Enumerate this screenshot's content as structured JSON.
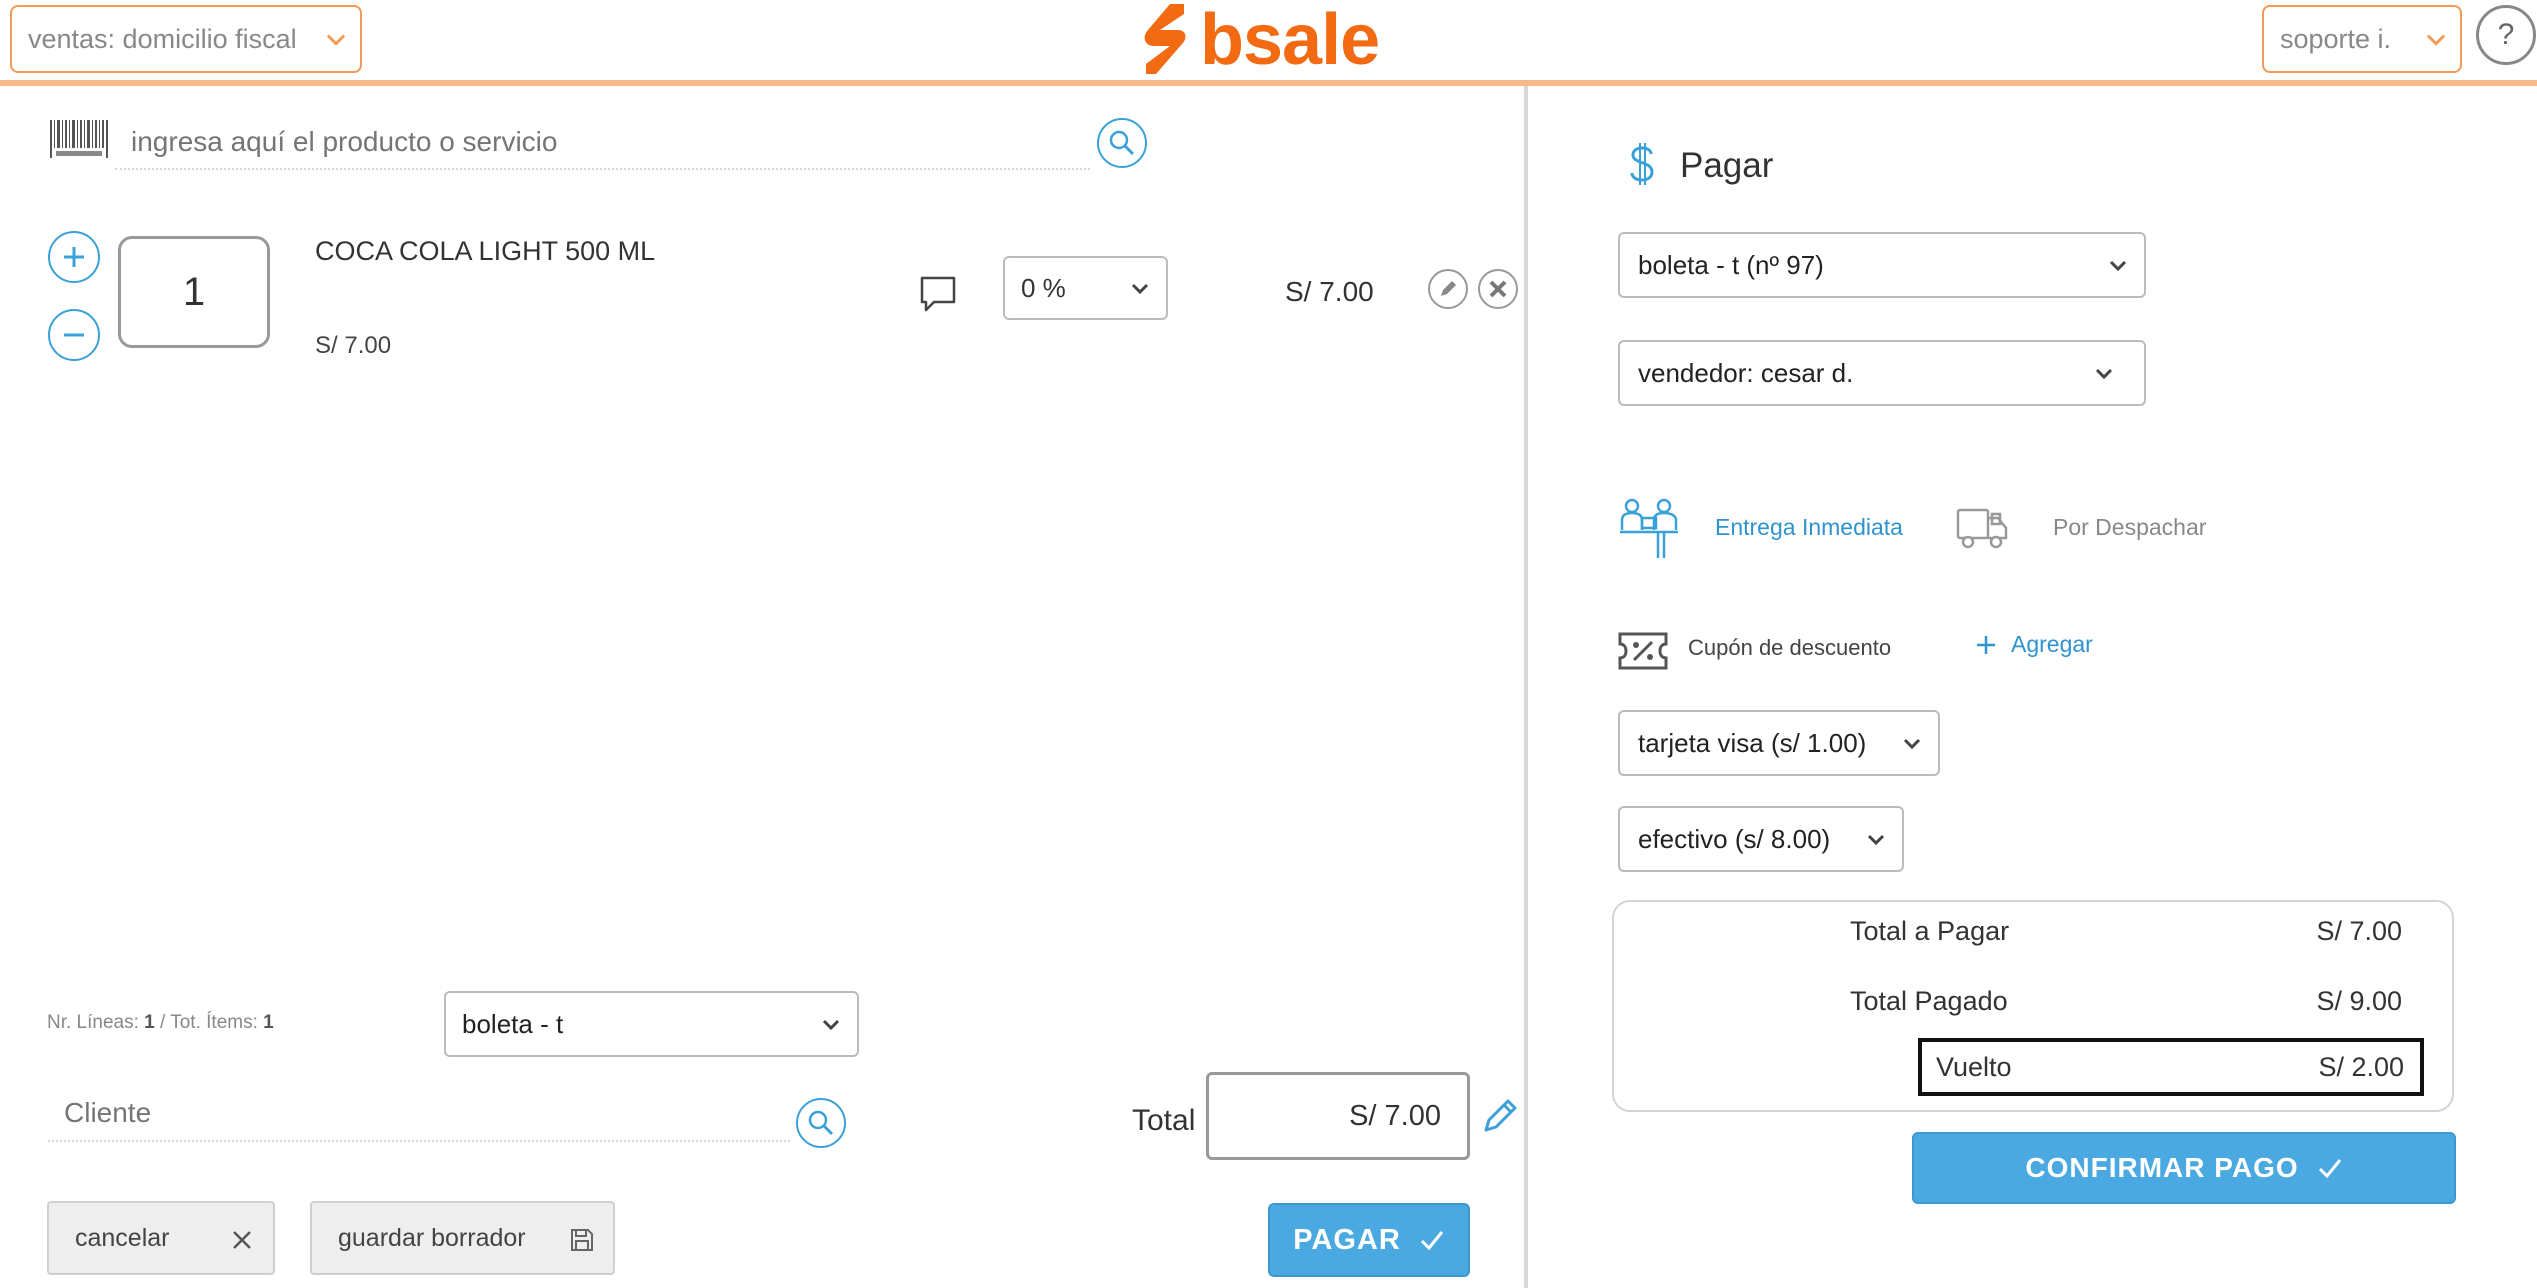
{
  "topbar": {
    "branch_select": "ventas: domicilio fiscal",
    "logo_text": "bsale",
    "user_select": "soporte i.",
    "help_label": "?"
  },
  "sale": {
    "search_placeholder": "ingresa aquí el producto o servicio",
    "items": [
      {
        "quantity": "1",
        "name": "COCA COLA LIGHT 500 ML",
        "unit_price": "S/ 7.00",
        "discount": "0 %",
        "total": "S/ 7.00"
      }
    ],
    "stats": {
      "lines_label": "Nr. Líneas: ",
      "lines_value": "1",
      "separator": " / Tot. Ítems: ",
      "items_value": "1"
    },
    "document_type": "boleta - t",
    "client_placeholder": "Cliente",
    "total_label": "Total",
    "total_value": "S/ 7.00",
    "cancel_label": "cancelar",
    "save_draft_label": "guardar borrador",
    "pay_label": "PAGAR"
  },
  "payment": {
    "heading": "Pagar",
    "document_number": "boleta - t (nº 97)",
    "seller": "vendedor: cesar d.",
    "delivery_immediate": "Entrega Inmediata",
    "delivery_dispatch": "Por Despachar",
    "coupon_label": "Cupón de descuento",
    "add_coupon_label": "Agregar",
    "methods": [
      "tarjeta visa (s/ 1.00)",
      "efectivo (s/ 8.00)"
    ],
    "summary": {
      "total_label": "Total a Pagar",
      "total_value": "S/ 7.00",
      "paid_label": "Total Pagado",
      "paid_value": "S/ 9.00",
      "change_label": "Vuelto",
      "change_value": "S/ 2.00"
    },
    "confirm_label": "CONFIRMAR PAGO"
  },
  "colors": {
    "brand_orange": "#f26a12",
    "accent_blue": "#4aa9e0",
    "link_blue": "#2e93cf"
  }
}
